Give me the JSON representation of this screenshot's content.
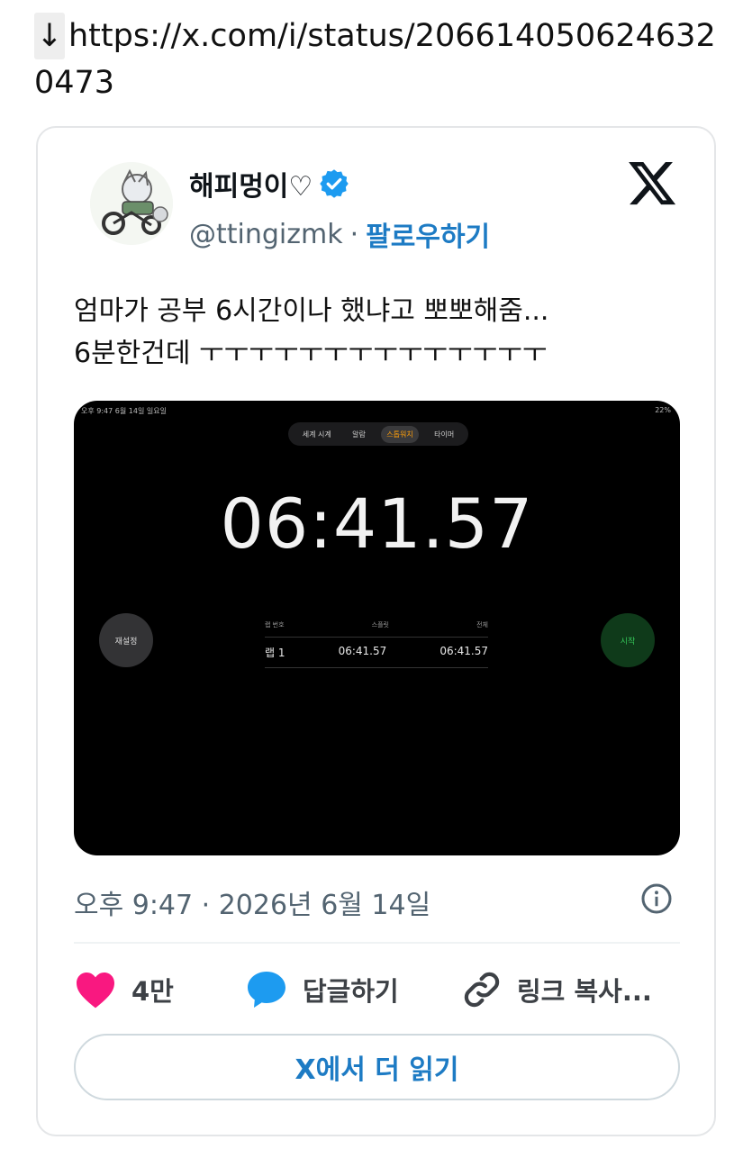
{
  "link": {
    "arrow": "↓",
    "url": "https://x.com/i/status/2066140506246320473"
  },
  "tweet": {
    "display_name": "해피멍이♡",
    "handle": "@ttingizmk",
    "separator": "·",
    "follow_label": "팔로우하기",
    "text_line1": "엄마가 공부 6시간이나 했냐고 뽀뽀해줌...",
    "text_line2": "6분한건데 ㅜㅜㅜㅜㅜㅜㅜㅜㅜㅜㅜㅜㅜㅜ",
    "timestamp": "오후 9:47 · 2026년 6월 14일",
    "likes": "4만",
    "reply_label": "답글하기",
    "copy_link_label": "링크 복사...",
    "read_more_label": "X에서 더 읽기"
  },
  "media": {
    "status_left": "오후 9:47  6월 14일 일요일",
    "status_right": "22%",
    "tabs": [
      {
        "label": "세계 시계",
        "active": false
      },
      {
        "label": "알람",
        "active": false
      },
      {
        "label": "스톱워치",
        "active": true
      },
      {
        "label": "타이머",
        "active": false
      }
    ],
    "time": "06:41.57",
    "reset_label": "재설정",
    "start_label": "시작",
    "lap_headers": [
      "랩 번호",
      "스플릿",
      "전체"
    ],
    "lap_rows": [
      {
        "lap": "랩 1",
        "split": "06:41.57",
        "total": "06:41.57"
      }
    ]
  },
  "colors": {
    "accent": "#1d7bc4",
    "like": "#f91880",
    "reply": "#1d9bf0",
    "verified": "#1d9bf0"
  },
  "icons": [
    "verified-badge-icon",
    "x-logo-icon",
    "info-icon",
    "heart-icon",
    "reply-bubble-icon",
    "link-icon"
  ]
}
